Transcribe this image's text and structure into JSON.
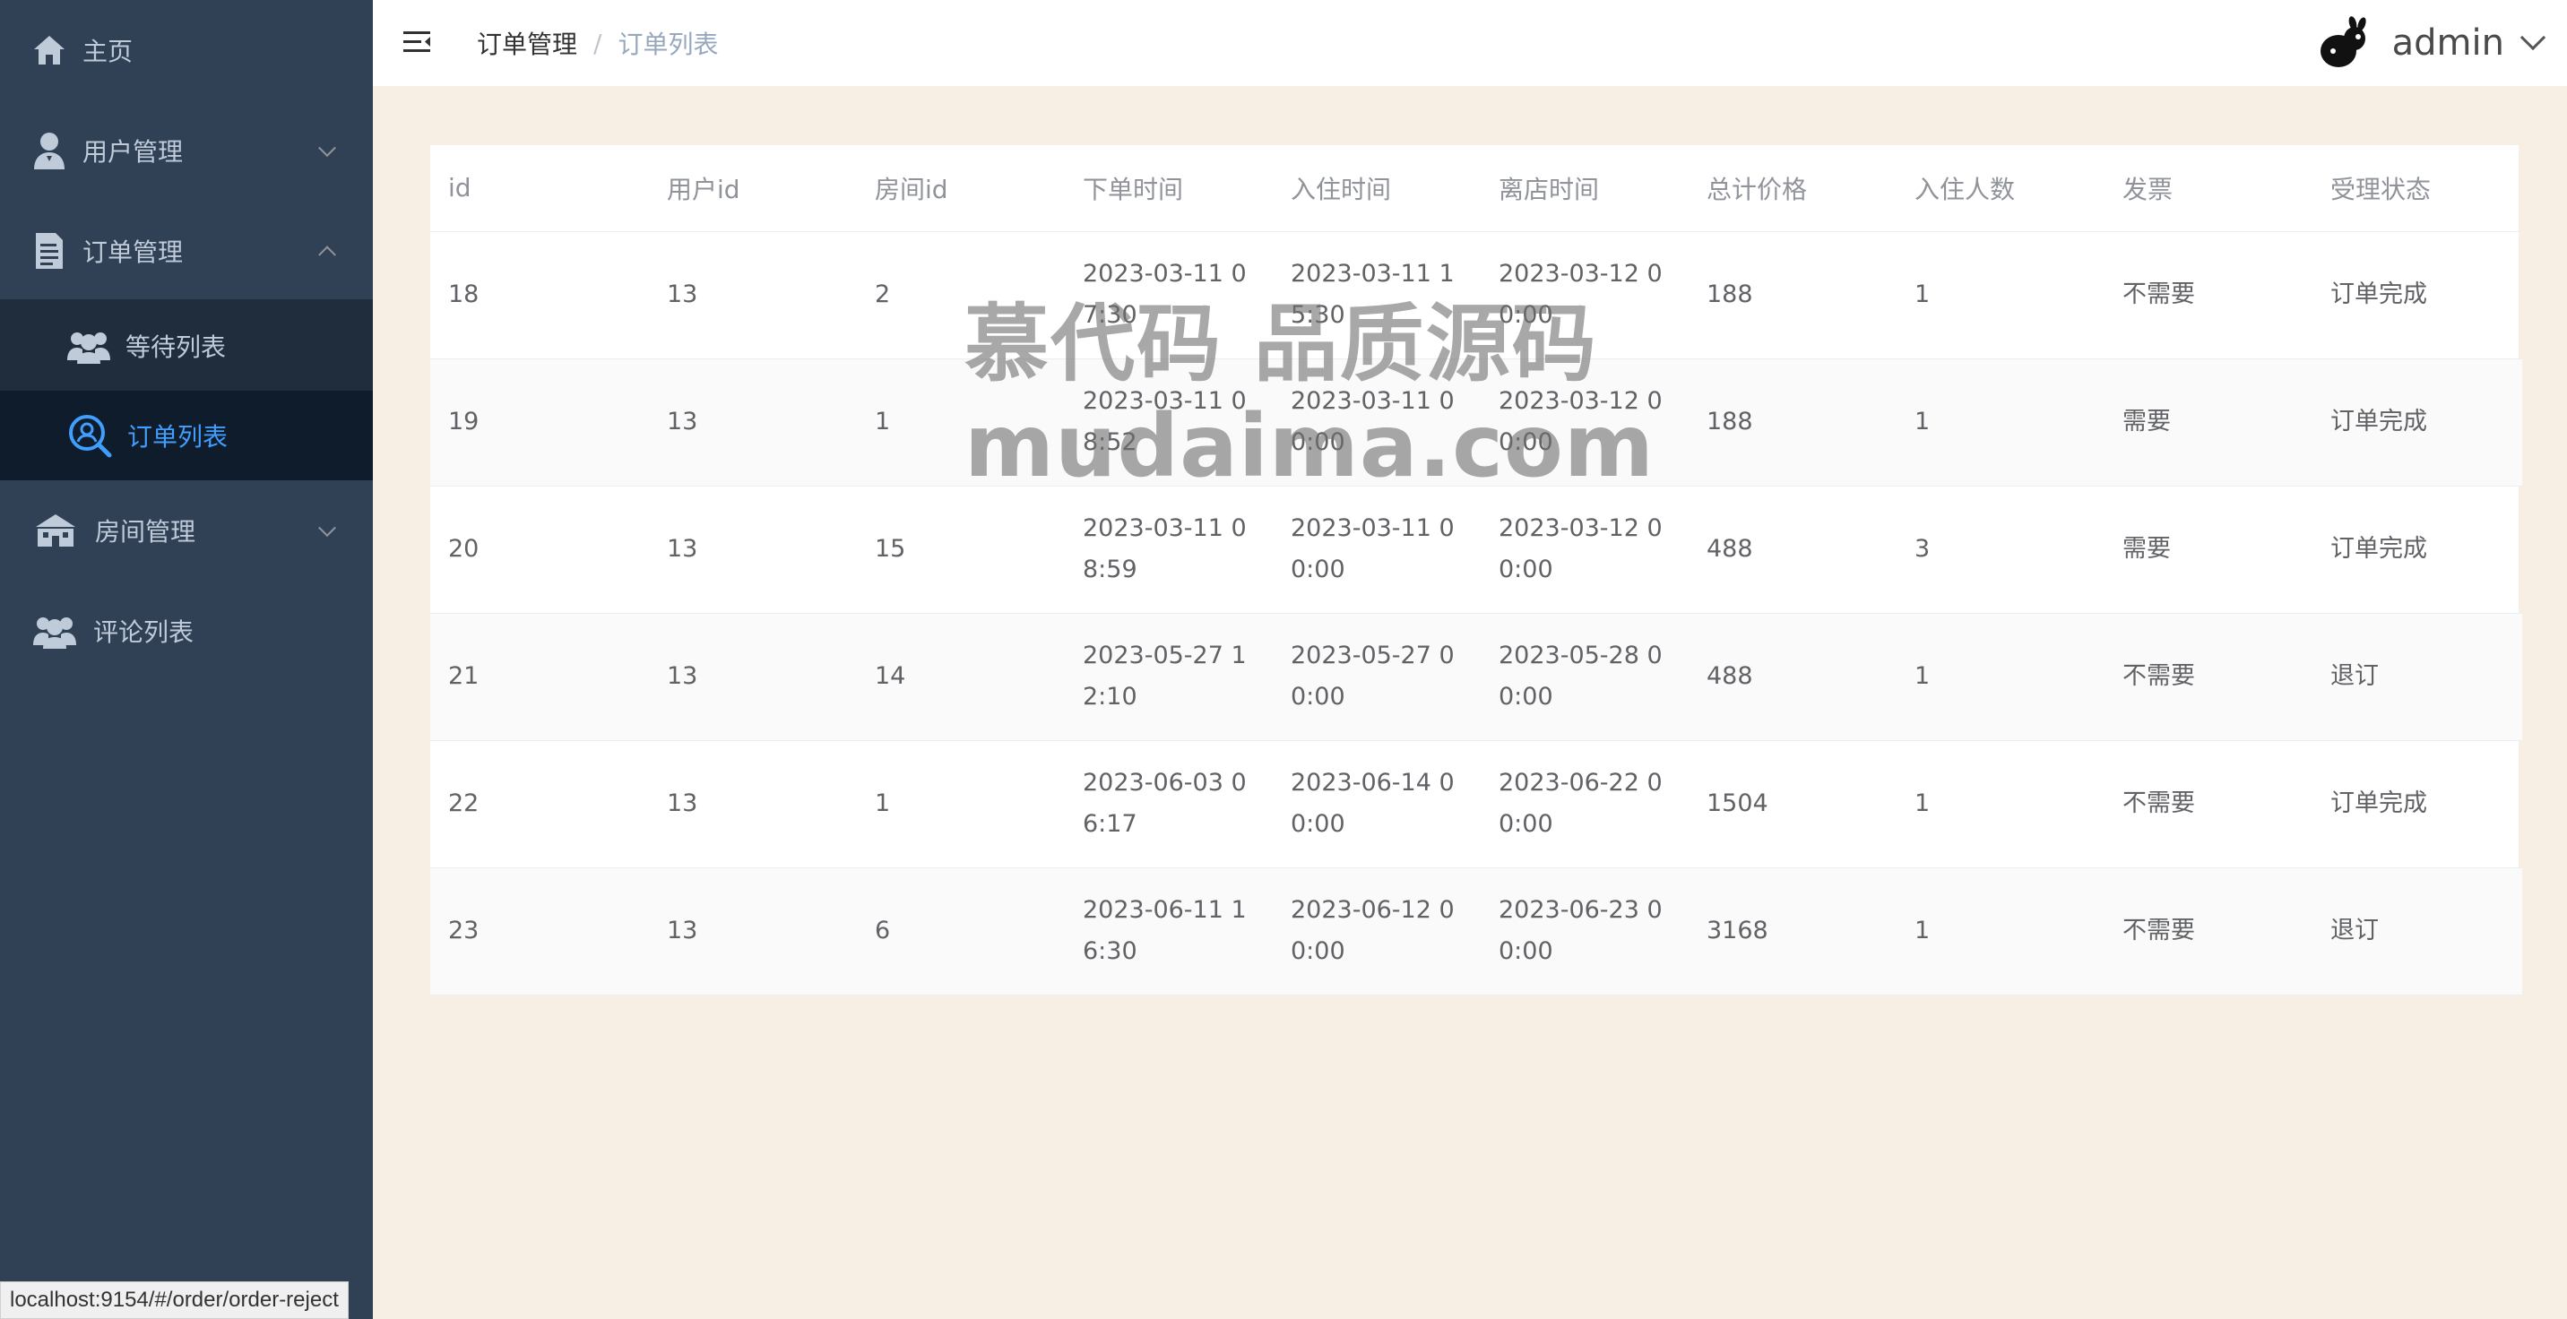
{
  "sidebar": {
    "items": [
      {
        "label": "主页",
        "icon": "home-icon"
      },
      {
        "label": "用户管理",
        "icon": "user-icon"
      },
      {
        "label": "订单管理",
        "icon": "document-icon"
      },
      {
        "label": "房间管理",
        "icon": "building-icon"
      },
      {
        "label": "评论列表",
        "icon": "users-icon"
      }
    ],
    "submenu": [
      {
        "label": "等待列表",
        "icon": "group-icon"
      },
      {
        "label": "订单列表",
        "icon": "search-icon",
        "active": true
      }
    ]
  },
  "header": {
    "breadcrumb": [
      "订单管理",
      "订单列表"
    ],
    "separator": "/",
    "username": "admin"
  },
  "table": {
    "headers": [
      "id",
      "用户id",
      "房间id",
      "下单时间",
      "入住时间",
      "离店时间",
      "总计价格",
      "入住人数",
      "发票",
      "受理状态"
    ],
    "rows": [
      [
        "18",
        "13",
        "2",
        "2023-03-11 07:30",
        "2023-03-11 15:30",
        "2023-03-12 00:00",
        "188",
        "1",
        "不需要",
        "订单完成"
      ],
      [
        "19",
        "13",
        "1",
        "2023-03-11 08:52",
        "2023-03-11 00:00",
        "2023-03-12 00:00",
        "188",
        "1",
        "需要",
        "订单完成"
      ],
      [
        "20",
        "13",
        "15",
        "2023-03-11 08:59",
        "2023-03-11 00:00",
        "2023-03-12 00:00",
        "488",
        "3",
        "需要",
        "订单完成"
      ],
      [
        "21",
        "13",
        "14",
        "2023-05-27 12:10",
        "2023-05-27 00:00",
        "2023-05-28 00:00",
        "488",
        "1",
        "不需要",
        "退订"
      ],
      [
        "22",
        "13",
        "1",
        "2023-06-03 06:17",
        "2023-06-14 00:00",
        "2023-06-22 00:00",
        "1504",
        "1",
        "不需要",
        "订单完成"
      ],
      [
        "23",
        "13",
        "6",
        "2023-06-11 16:30",
        "2023-06-12 00:00",
        "2023-06-23 00:00",
        "3168",
        "1",
        "不需要",
        "退订"
      ]
    ]
  },
  "watermark": {
    "line1": "慕代码 品质源码",
    "line2": "mudaima.com"
  },
  "status_bar": {
    "url": "localhost:9154/#/order/order-reject"
  },
  "colors": {
    "sidebar_bg": "#304156",
    "submenu_bg": "#1f2d3d",
    "active_text": "#409eff",
    "page_bg": "#f8efe4"
  }
}
